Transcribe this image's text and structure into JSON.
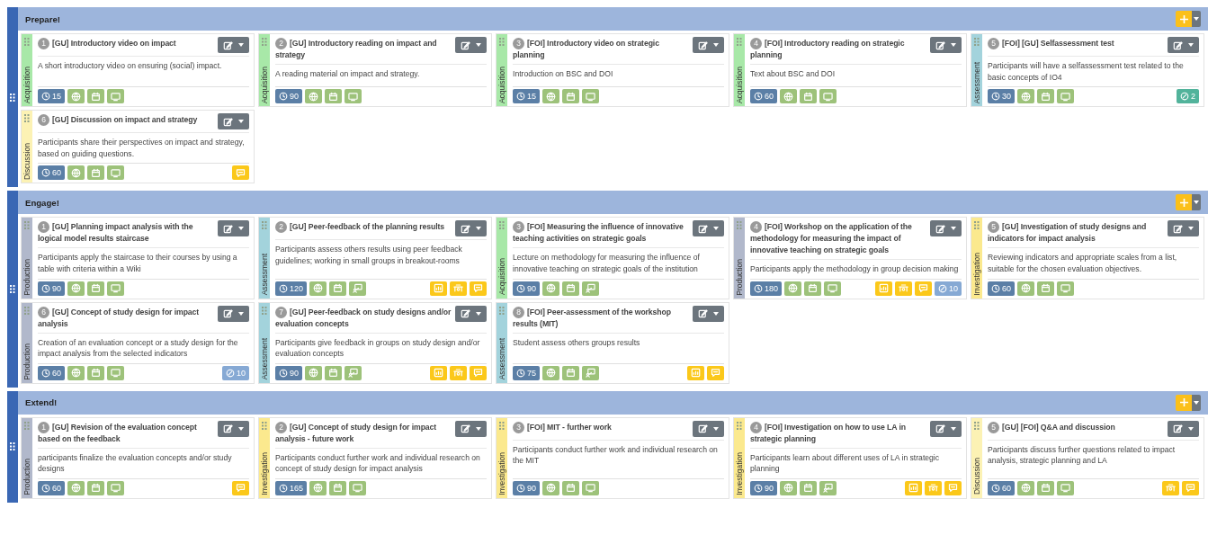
{
  "sections": [
    {
      "title": "Prepare!",
      "cards": [
        {
          "number": "1",
          "title": "[GU] Introductory video on impact",
          "description": "A short introductory video on ensuring (social) impact.",
          "type": "Acquisition",
          "color": "#a8e8a8",
          "duration": "15",
          "tools": [
            {
              "kind": "globe"
            },
            {
              "kind": "calendar"
            },
            {
              "kind": "screen"
            }
          ]
        },
        {
          "number": "2",
          "title": "[GU] Introductory reading on impact and strategy",
          "description": "A reading material on impact and strategy.",
          "type": "Acquisition",
          "color": "#a8e8a8",
          "duration": "90",
          "tools": [
            {
              "kind": "globe"
            },
            {
              "kind": "calendar"
            },
            {
              "kind": "screen"
            }
          ]
        },
        {
          "number": "3",
          "title": "[FOI] Introductory video on strategic planning",
          "description": "Introduction on BSC and DOI",
          "type": "Acquisition",
          "color": "#a8e8a8",
          "duration": "15",
          "tools": [
            {
              "kind": "globe"
            },
            {
              "kind": "calendar"
            },
            {
              "kind": "screen"
            }
          ]
        },
        {
          "number": "4",
          "title": "[FOI] Introductory reading on strategic planning",
          "description": "Text about BSC and DOI",
          "type": "Acquisition",
          "color": "#a8e8a8",
          "duration": "60",
          "tools": [
            {
              "kind": "globe"
            },
            {
              "kind": "calendar"
            },
            {
              "kind": "screen"
            }
          ]
        },
        {
          "number": "5",
          "title": "[FOI] [GU] Selfassessment test",
          "description": "Participants will have a selfassessment test related to the basic concepts of IO4",
          "type": "Assessment",
          "color": "#a3d3dc",
          "duration": "30",
          "tools": [
            {
              "kind": "globe"
            },
            {
              "kind": "calendar"
            },
            {
              "kind": "screen"
            }
          ],
          "counter": {
            "value": "2",
            "color": "#52b39b"
          }
        },
        {
          "number": "6",
          "title": "[GU] Discussion on impact and strategy",
          "description": "Participants share their perspectives on impact and strategy, based on guiding questions.",
          "type": "Discussion",
          "color": "#fcf2b4",
          "duration": "60",
          "tools": [
            {
              "kind": "globe"
            },
            {
              "kind": "calendar"
            },
            {
              "kind": "screen"
            }
          ],
          "extras": [
            {
              "kind": "comment"
            }
          ]
        }
      ]
    },
    {
      "title": "Engage!",
      "cards": [
        {
          "number": "1",
          "title": "[GU] Planning impact analysis with the logical model results staircase",
          "description": "Participants apply the staircase to their courses by using a table with criteria within a Wiki",
          "type": "Production",
          "color": "#b1b8cb",
          "duration": "90",
          "tools": [
            {
              "kind": "globe"
            },
            {
              "kind": "calendar"
            },
            {
              "kind": "screen"
            }
          ]
        },
        {
          "number": "2",
          "title": "[GU] Peer-feedback of the planning results",
          "description": "Participants assess others results using peer feedback guidelines; working in small groups in breakout-rooms",
          "type": "Assessment",
          "color": "#a3d3dc",
          "duration": "120",
          "tools": [
            {
              "kind": "globe"
            },
            {
              "kind": "calendar"
            },
            {
              "kind": "presenter"
            }
          ],
          "extras": [
            {
              "kind": "board"
            },
            {
              "kind": "group"
            },
            {
              "kind": "comment"
            }
          ]
        },
        {
          "number": "3",
          "title": "[FOI] Measuring the influence of innovative teaching activities on strategic goals",
          "description": "Lecture on methodology for measuring the influence of innovative teaching on strategic goals of the institution",
          "type": "Acquisition",
          "color": "#a8e8a8",
          "duration": "90",
          "tools": [
            {
              "kind": "globe"
            },
            {
              "kind": "calendar"
            },
            {
              "kind": "presenter"
            }
          ]
        },
        {
          "number": "4",
          "title": "[FOI] Workshop on the application of the methodology for measuring the impact of innovative teaching on strategic goals",
          "description": "Participants apply the methodology in group decision making",
          "type": "Production",
          "color": "#b1b8cb",
          "duration": "180",
          "tools": [
            {
              "kind": "globe"
            },
            {
              "kind": "calendar"
            },
            {
              "kind": "screen"
            }
          ],
          "extras": [
            {
              "kind": "board"
            },
            {
              "kind": "group"
            },
            {
              "kind": "comment"
            }
          ],
          "counter": {
            "value": "10",
            "color": "#86a9d4"
          }
        },
        {
          "number": "5",
          "title": "[GU] Investigation of study designs and indicators for impact analysis",
          "description": "Reviewing indicators and appropriate scales from a list, suitable for the chosen evaluation objectives.",
          "type": "Investigation",
          "color": "#fbe98e",
          "duration": "60",
          "tools": [
            {
              "kind": "globe"
            },
            {
              "kind": "calendar"
            },
            {
              "kind": "screen"
            }
          ]
        },
        {
          "number": "6",
          "title": "[GU] Concept of study design for impact analysis",
          "description": "Creation of an evaluation concept or a study design for the impact analysis from the selected indicators",
          "type": "Production",
          "color": "#b1b8cb",
          "duration": "60",
          "tools": [
            {
              "kind": "globe"
            },
            {
              "kind": "calendar"
            },
            {
              "kind": "screen"
            }
          ],
          "counter": {
            "value": "10",
            "color": "#86a9d4"
          }
        },
        {
          "number": "7",
          "title": "[GU] Peer-feedback on study designs and/or evaluation concepts",
          "description": "Participants give feedback in groups on study design and/or evaluation concepts",
          "type": "Assessment",
          "color": "#a3d3dc",
          "duration": "90",
          "tools": [
            {
              "kind": "globe"
            },
            {
              "kind": "calendar"
            },
            {
              "kind": "presenter"
            }
          ],
          "extras": [
            {
              "kind": "board"
            },
            {
              "kind": "group"
            },
            {
              "kind": "comment"
            }
          ]
        },
        {
          "number": "8",
          "title": "[FOI] Peer-assessment of the workshop results (MIT)",
          "description": "Student assess others groups results",
          "type": "Assessment",
          "color": "#a3d3dc",
          "duration": "75",
          "tools": [
            {
              "kind": "globe"
            },
            {
              "kind": "calendar"
            },
            {
              "kind": "presenter"
            }
          ],
          "extras": [
            {
              "kind": "board"
            },
            {
              "kind": "comment"
            }
          ]
        }
      ]
    },
    {
      "title": "Extend!",
      "cards": [
        {
          "number": "1",
          "title": "[GU] Revision of the evaluation concept based on the feedback",
          "description": "participants finalize the evaluation concepts and/or study designs",
          "type": "Production",
          "color": "#b1b8cb",
          "duration": "60",
          "tools": [
            {
              "kind": "globe"
            },
            {
              "kind": "calendar"
            },
            {
              "kind": "screen"
            }
          ],
          "extras": [
            {
              "kind": "comment"
            }
          ]
        },
        {
          "number": "2",
          "title": "[GU] Concept of study design for impact analysis - future work",
          "description": "Participants conduct further work and individual research on concept of study design for impact analysis",
          "type": "Investigation",
          "color": "#fbe98e",
          "duration": "165",
          "tools": [
            {
              "kind": "globe"
            },
            {
              "kind": "calendar"
            },
            {
              "kind": "screen"
            }
          ]
        },
        {
          "number": "3",
          "title": "[FOI] MIT - further work",
          "description": "Participants conduct further work and individual research on the MIT",
          "type": "Investigation",
          "color": "#fbe98e",
          "duration": "90",
          "tools": [
            {
              "kind": "globe"
            },
            {
              "kind": "calendar"
            },
            {
              "kind": "screen"
            }
          ]
        },
        {
          "number": "4",
          "title": "[FOI] Investigation on how to use LA in strategic planning",
          "description": "Participants learn about different uses of LA in strategic planning",
          "type": "Investigation",
          "color": "#fbe98e",
          "duration": "90",
          "tools": [
            {
              "kind": "globe"
            },
            {
              "kind": "calendar"
            },
            {
              "kind": "presenter"
            }
          ],
          "extras": [
            {
              "kind": "board"
            },
            {
              "kind": "group"
            },
            {
              "kind": "comment"
            }
          ]
        },
        {
          "number": "5",
          "title": "[GU] [FOI] Q&A and discussion",
          "description": "Participants discuss further questions related to impact analysis, strategic planning and LA",
          "type": "Discussion",
          "color": "#fcf2b4",
          "duration": "60",
          "tools": [
            {
              "kind": "globe"
            },
            {
              "kind": "calendar"
            },
            {
              "kind": "screen"
            }
          ],
          "extras": [
            {
              "kind": "group"
            },
            {
              "kind": "comment"
            }
          ]
        }
      ]
    }
  ]
}
